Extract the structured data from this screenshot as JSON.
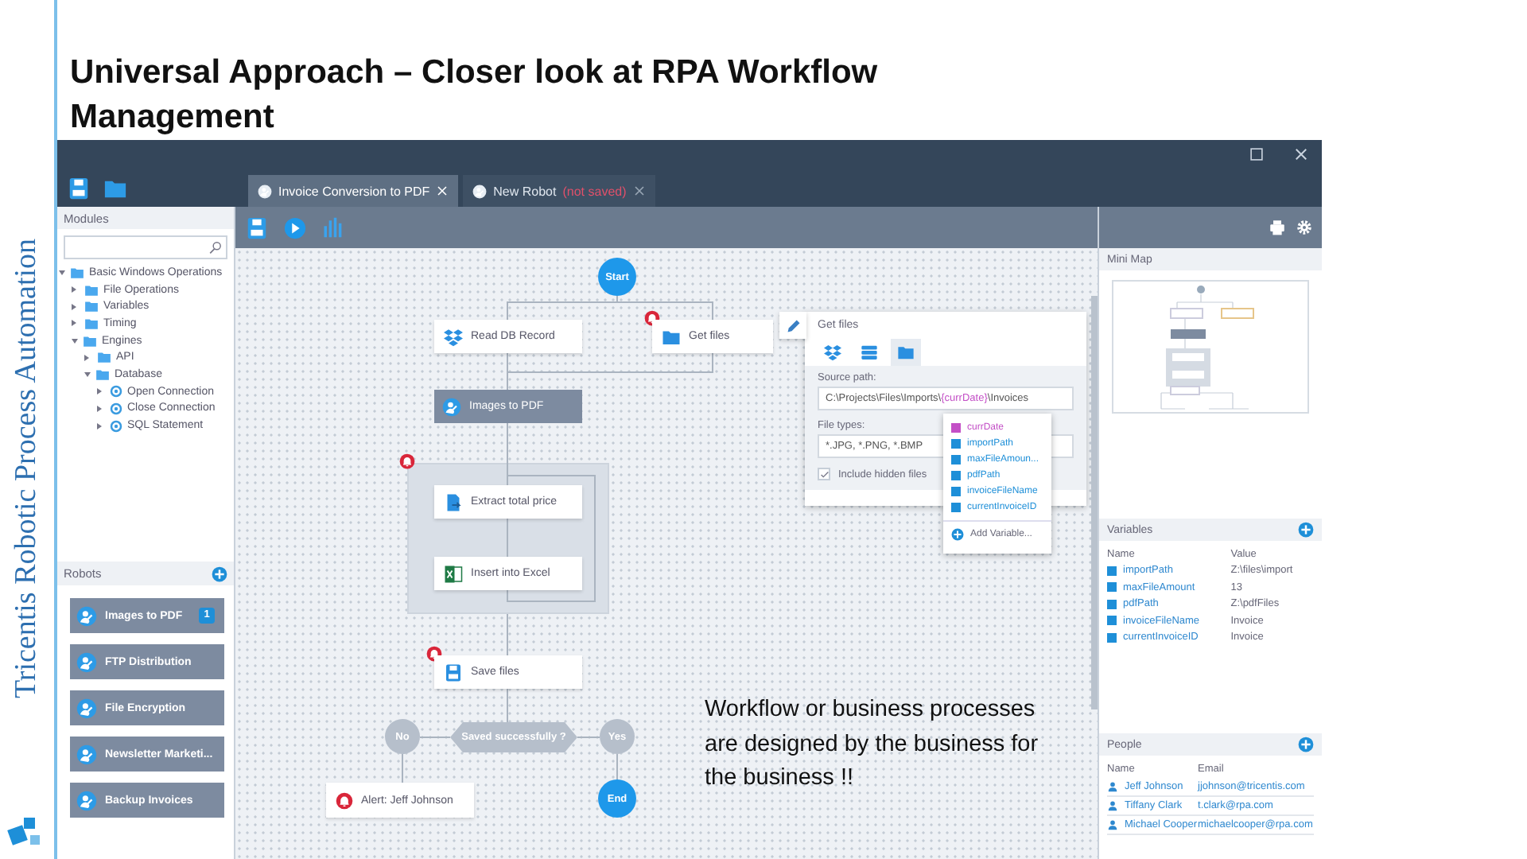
{
  "slide": {
    "title": "Universal Approach – Closer look at RPA Workflow Management",
    "side_text": "Tricentis Robotic Process Automation",
    "note": "Workflow or business processes are designed by the business for the business !!"
  },
  "tabs": [
    {
      "label": "Invoice Conversion to PDF",
      "selected": true
    },
    {
      "label": "New Robot",
      "note": "(not saved)",
      "selected": false
    }
  ],
  "modules": {
    "title": "Modules",
    "tree": [
      {
        "label": "Basic Windows Operations",
        "kind": "folder",
        "expanded": true,
        "children": [
          {
            "label": "File Operations",
            "kind": "folder",
            "expanded": false
          },
          {
            "label": "Variables",
            "kind": "folder",
            "expanded": false
          },
          {
            "label": "Timing",
            "kind": "folder",
            "expanded": false
          },
          {
            "label": "Engines",
            "kind": "folder",
            "expanded": true,
            "children": [
              {
                "label": "API",
                "kind": "folder",
                "expanded": false
              },
              {
                "label": "Database",
                "kind": "folder",
                "expanded": true,
                "children": [
                  {
                    "label": "Open Connection",
                    "kind": "module",
                    "expanded": false
                  },
                  {
                    "label": "Close Connection",
                    "kind": "module",
                    "expanded": false
                  },
                  {
                    "label": "SQL Statement",
                    "kind": "module",
                    "expanded": false
                  }
                ]
              }
            ]
          }
        ]
      }
    ]
  },
  "robots": {
    "title": "Robots",
    "items": [
      {
        "label": "Images to PDF",
        "badge": "1"
      },
      {
        "label": "FTP Distribution"
      },
      {
        "label": "File Encryption"
      },
      {
        "label": "Newsletter Marketi..."
      },
      {
        "label": "Backup Invoices"
      }
    ]
  },
  "flow": {
    "nodes": [
      {
        "kind": "start",
        "label": "Start"
      },
      {
        "kind": "step",
        "label": "Read DB Record",
        "alert": false
      },
      {
        "kind": "step",
        "label": "Get files",
        "alert": true
      },
      {
        "kind": "robot",
        "label": "Images to PDF",
        "alert": false
      },
      {
        "kind": "group",
        "alert": true
      },
      {
        "kind": "step",
        "label": "Extract total price",
        "alert": false
      },
      {
        "kind": "step",
        "label": "Insert into Excel",
        "alert": false
      },
      {
        "kind": "step",
        "label": "Save files",
        "alert": true
      },
      {
        "kind": "branch",
        "label": "No"
      },
      {
        "kind": "decision",
        "label": "Saved successfully ?"
      },
      {
        "kind": "branch",
        "label": "Yes"
      },
      {
        "kind": "end",
        "label": "End"
      },
      {
        "kind": "alert",
        "label": "Alert: Jeff Johnson"
      }
    ]
  },
  "editor": {
    "title": "Get files",
    "source_tabs": [
      {
        "selected": false
      },
      {
        "selected": false
      },
      {
        "selected": true
      }
    ],
    "source_label": "Source path:",
    "path_start": "C:\\Projects\\Files\\Imports\\",
    "path_variable": "{currDate}",
    "path_end": "\\Invoices",
    "types_label": "File types:",
    "types_value": "*.JPG, *.PNG, *.BMP",
    "hidden_label": "Include hidden files",
    "hidden_checked": true,
    "suggestions": [
      {
        "label": "currDate",
        "color": "#c34fc6"
      },
      {
        "label": "importPath",
        "color": "#1e8fd8"
      },
      {
        "label": "maxFileAmoun...",
        "color": "#1e8fd8"
      },
      {
        "label": "pdfPath",
        "color": "#1e8fd8"
      },
      {
        "label": "invoiceFileName",
        "color": "#1e8fd8"
      },
      {
        "label": "currentInvoiceID",
        "color": "#1e8fd8"
      }
    ],
    "add_label": "Add Variable..."
  },
  "minimap": {
    "title": "Mini Map"
  },
  "variables": {
    "title": "Variables",
    "columns": [
      "Name",
      "Value"
    ],
    "rows": [
      {
        "name": "importPath",
        "value": "Z:\\files\\import"
      },
      {
        "name": "maxFileAmount",
        "value": "13"
      },
      {
        "name": "pdfPath",
        "value": "Z:\\pdfFiles"
      },
      {
        "name": "invoiceFileName",
        "value": "Invoice"
      },
      {
        "name": "currentInvoiceID",
        "value": "Invoice"
      }
    ]
  },
  "people": {
    "title": "People",
    "columns": [
      "Name",
      "Email"
    ],
    "rows": [
      {
        "name": "Jeff Johnson",
        "email": "jjohnson@tricentis.com"
      },
      {
        "name": "Tiffany Clark",
        "email": "t.clark@rpa.com"
      },
      {
        "name": "Michael Cooper",
        "email": "michaelcooper@rpa.com"
      }
    ]
  }
}
